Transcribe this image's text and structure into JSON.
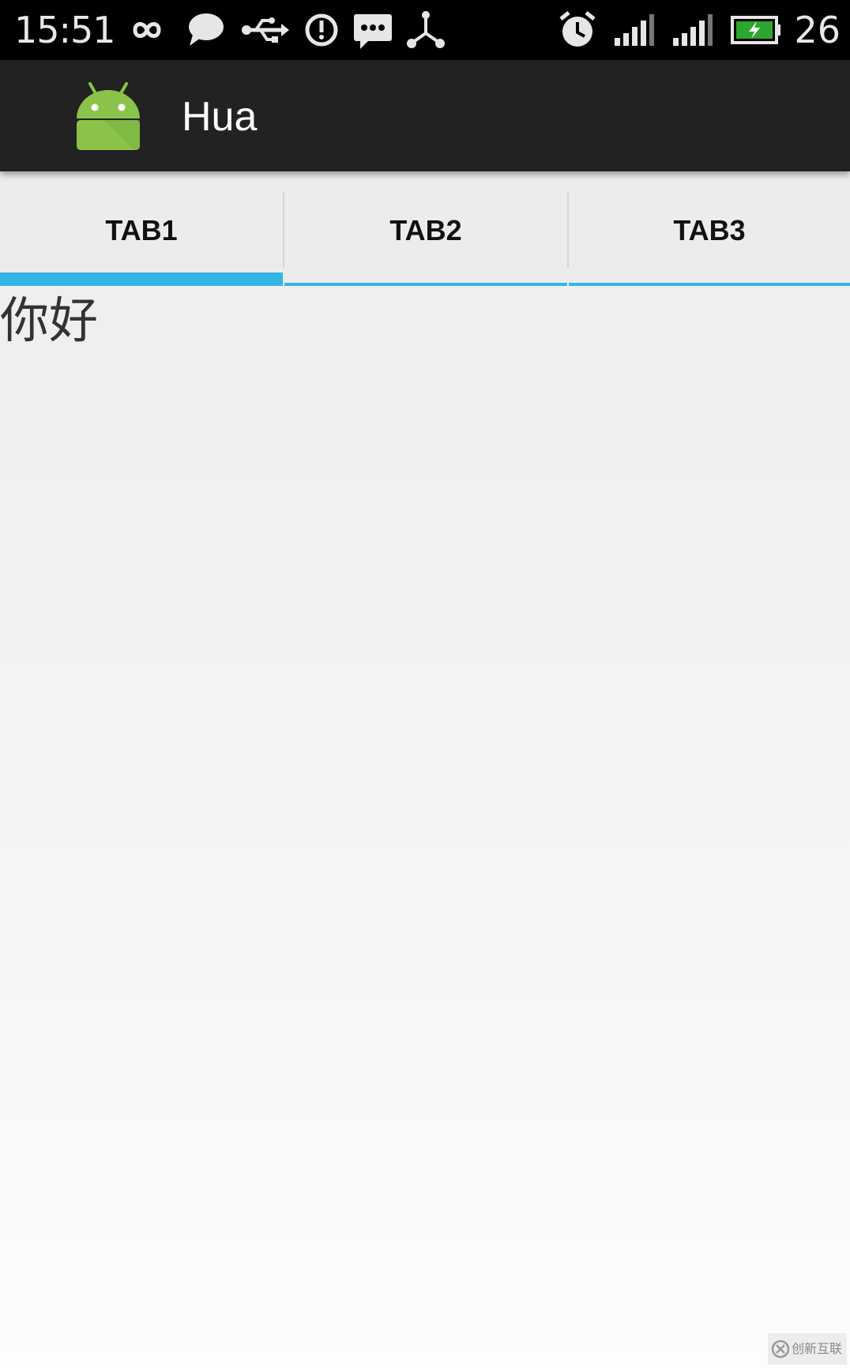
{
  "status_bar": {
    "time": "15:51",
    "battery_level": "26",
    "icons": [
      "infinity-icon",
      "chat-bubble-icon",
      "usb-icon",
      "alert-icon",
      "message-icon",
      "share-icon",
      "alarm-icon",
      "signal-icon",
      "signal-icon",
      "battery-charging-icon"
    ]
  },
  "action_bar": {
    "icon": "android-robot-icon",
    "title": "Hua"
  },
  "tabs": [
    {
      "label": "TAB1",
      "selected": true
    },
    {
      "label": "TAB2",
      "selected": false
    },
    {
      "label": "TAB3",
      "selected": false
    }
  ],
  "content": {
    "text": "你好"
  },
  "watermark": {
    "text": "创新互联"
  },
  "colors": {
    "status_bar_bg": "#000000",
    "action_bar_bg": "#222222",
    "tab_indicator": "#33b5e5",
    "android_green": "#8bc34a"
  }
}
